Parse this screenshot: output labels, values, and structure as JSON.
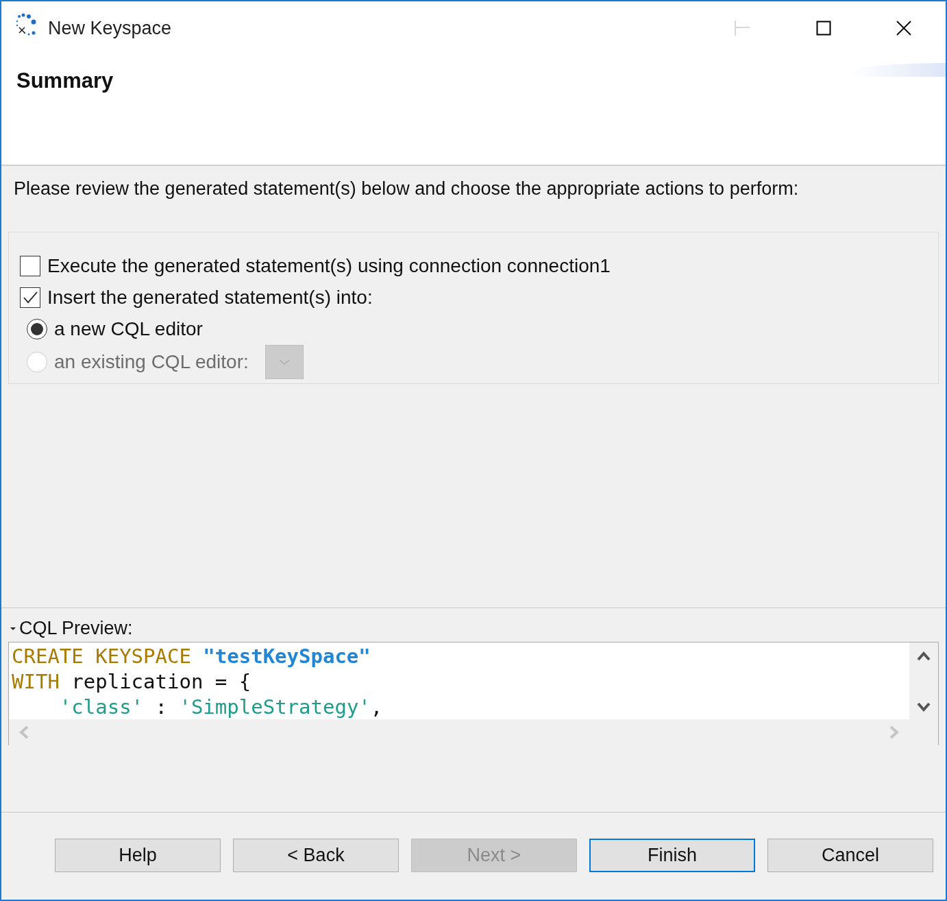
{
  "window": {
    "title": "New Keyspace"
  },
  "header": {
    "title": "Summary"
  },
  "prompt": "Please review the generated statement(s) below and choose the appropriate actions to perform:",
  "options": [
    {
      "label": "Execute the generated statement(s) using connection connection1",
      "checked": false
    },
    {
      "label": "Insert the generated statement(s) into:",
      "checked": true
    }
  ],
  "targets": [
    {
      "label": "a new CQL editor",
      "selected": true,
      "disabled": false,
      "has_dropdown": false
    },
    {
      "label": "an existing CQL editor:",
      "selected": false,
      "disabled": true,
      "has_dropdown": true
    }
  ],
  "preview": {
    "label": "CQL Preview:",
    "expanded": true,
    "lines": [
      [
        {
          "kind": "keyword",
          "text": "CREATE KEYSPACE "
        },
        {
          "kind": "name",
          "text": "\"testKeySpace\""
        }
      ],
      [
        {
          "kind": "keyword",
          "text": "WITH"
        },
        {
          "kind": "plain",
          "text": " replication = {"
        }
      ],
      [
        {
          "kind": "string",
          "text": "    'class'"
        },
        {
          "kind": "plain",
          "text": " : "
        },
        {
          "kind": "string",
          "text": "'SimpleStrategy'"
        },
        {
          "kind": "plain",
          "text": ","
        }
      ]
    ]
  },
  "buttons": [
    {
      "label": "Help",
      "disabled": false,
      "default": false
    },
    {
      "label": "< Back",
      "disabled": false,
      "default": false
    },
    {
      "label": "Next >",
      "disabled": true,
      "default": false
    },
    {
      "label": "Finish",
      "disabled": false,
      "default": true
    },
    {
      "label": "Cancel",
      "disabled": false,
      "default": false
    }
  ]
}
